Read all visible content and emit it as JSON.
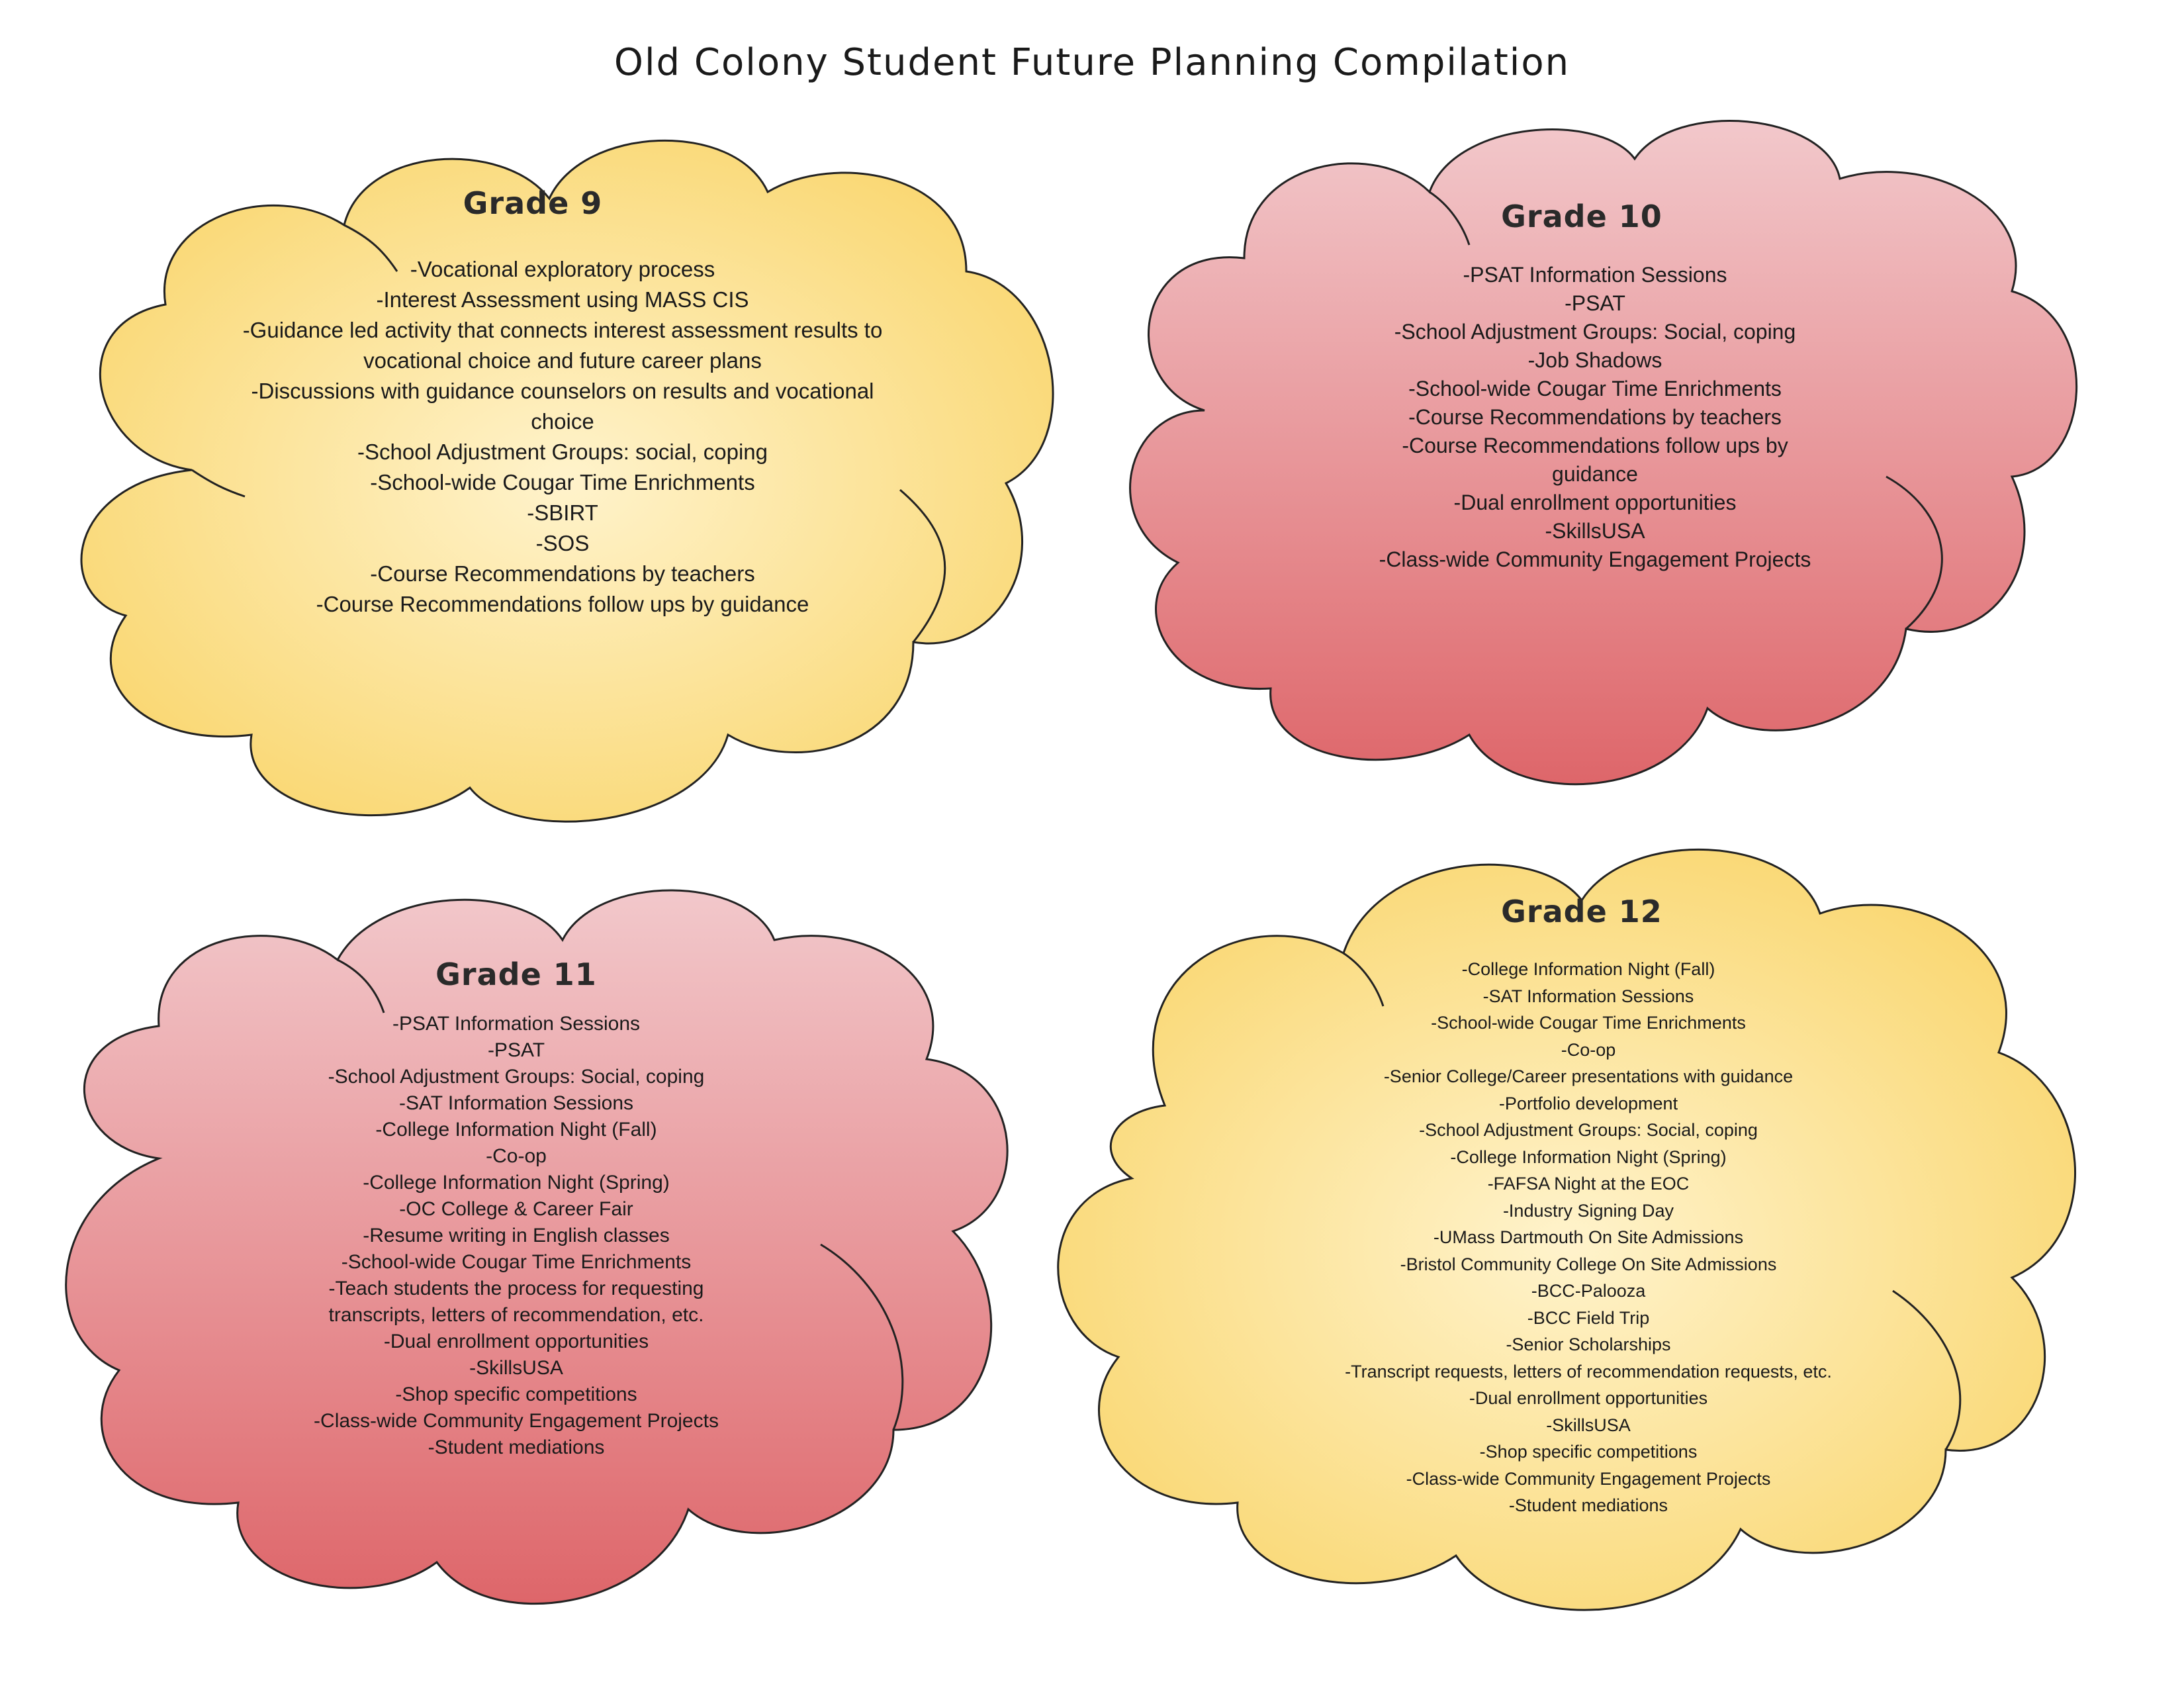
{
  "page_title": "Old Colony Student Future Planning Compilation",
  "colors": {
    "yellow_center": "#FFF3CC",
    "yellow_edge": "#F9D66E",
    "pink_top": "#F2C8CB",
    "red_bottom": "#DE666A",
    "outline": "#222222"
  },
  "grades": [
    {
      "title": "Grade 9",
      "items": [
        "-Vocational exploratory process",
        "-Interest Assessment using MASS CIS",
        "-Guidance led activity that connects interest assessment results to",
        "vocational choice and future career plans",
        "-Discussions with guidance counselors on results and vocational",
        "choice",
        "-School Adjustment Groups: social, coping",
        "-School-wide Cougar Time Enrichments",
        "-SBIRT",
        "-SOS",
        "-Course Recommendations by teachers",
        "-Course Recommendations follow ups by guidance"
      ]
    },
    {
      "title": "Grade 10",
      "items": [
        "-PSAT Information Sessions",
        "-PSAT",
        "-School Adjustment Groups: Social, coping",
        "-Job Shadows",
        "-School-wide Cougar Time Enrichments",
        "-Course Recommendations by teachers",
        "-Course Recommendations follow ups by",
        "guidance",
        "-Dual enrollment opportunities",
        "-SkillsUSA",
        "-Class-wide Community Engagement Projects"
      ]
    },
    {
      "title": "Grade 11",
      "items": [
        "-PSAT Information Sessions",
        "-PSAT",
        "-School Adjustment Groups: Social, coping",
        "-SAT Information Sessions",
        "-College Information Night (Fall)",
        "-Co-op",
        "-College Information Night (Spring)",
        "-OC College & Career Fair",
        "-Resume writing in English classes",
        "-School-wide Cougar Time Enrichments",
        "-Teach students the process for requesting",
        "transcripts, letters of recommendation, etc.",
        "-Dual enrollment opportunities",
        "-SkillsUSA",
        "-Shop specific competitions",
        "-Class-wide Community Engagement Projects",
        "-Student mediations"
      ]
    },
    {
      "title": "Grade 12",
      "items": [
        "-College Information Night (Fall)",
        "-SAT Information Sessions",
        "-School-wide Cougar Time Enrichments",
        "-Co-op",
        "-Senior College/Career presentations with guidance",
        "-Portfolio development",
        "-School Adjustment Groups: Social, coping",
        "-College Information Night (Spring)",
        "-FAFSA Night at the EOC",
        "-Industry Signing Day",
        "-UMass Dartmouth On Site Admissions",
        "-Bristol Community College On Site Admissions",
        "-BCC-Palooza",
        "-BCC Field Trip",
        "-Senior Scholarships",
        "-Transcript requests, letters of recommendation requests, etc.",
        "-Dual enrollment opportunities",
        "-SkillsUSA",
        "-Shop specific competitions",
        "-Class-wide Community Engagement Projects",
        "-Student mediations"
      ]
    }
  ]
}
